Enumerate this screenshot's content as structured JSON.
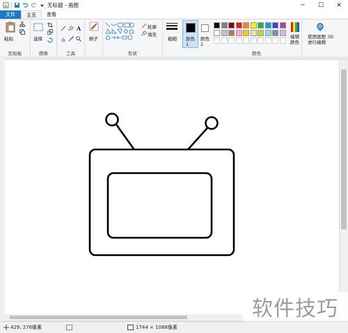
{
  "window": {
    "title": "无标题 - 画图",
    "minimize": "─",
    "maximize": "☐",
    "close": "✕"
  },
  "tabs": [
    "文件",
    "主页",
    "查看"
  ],
  "ribbon": {
    "clipboard": {
      "paste": "粘贴",
      "label": "剪贴板"
    },
    "image": {
      "select": "选择",
      "label": "图像"
    },
    "tools": {
      "label": "工具"
    },
    "brush": {
      "label": "刷子"
    },
    "shapes": {
      "outline": "轮廓",
      "fill": "填充",
      "label": "形状"
    },
    "size": {
      "label": "粗细"
    },
    "color1": {
      "label": "颜色 1"
    },
    "color2": {
      "label": "颜色 2"
    },
    "colors": {
      "label": "颜色",
      "edit": "编辑颜色",
      "row1": [
        "#000000",
        "#7f7f7f",
        "#880015",
        "#ed1c24",
        "#ff7f27",
        "#fff200",
        "#22b14c",
        "#00a2e8",
        "#3f48cc",
        "#a349a4"
      ],
      "row2": [
        "#ffffff",
        "#c3c3c3",
        "#b97a57",
        "#ffaec9",
        "#ffc90e",
        "#efe4b0",
        "#b5e61d",
        "#99d9ea",
        "#7092be",
        "#c8bfe7"
      ]
    },
    "paint3d": {
      "label": "使用画图 3D 进行编辑"
    }
  },
  "status": {
    "cursor": "429, 276像素",
    "canvas_size": "1744 × 1088像素"
  },
  "watermark": "软件技巧"
}
